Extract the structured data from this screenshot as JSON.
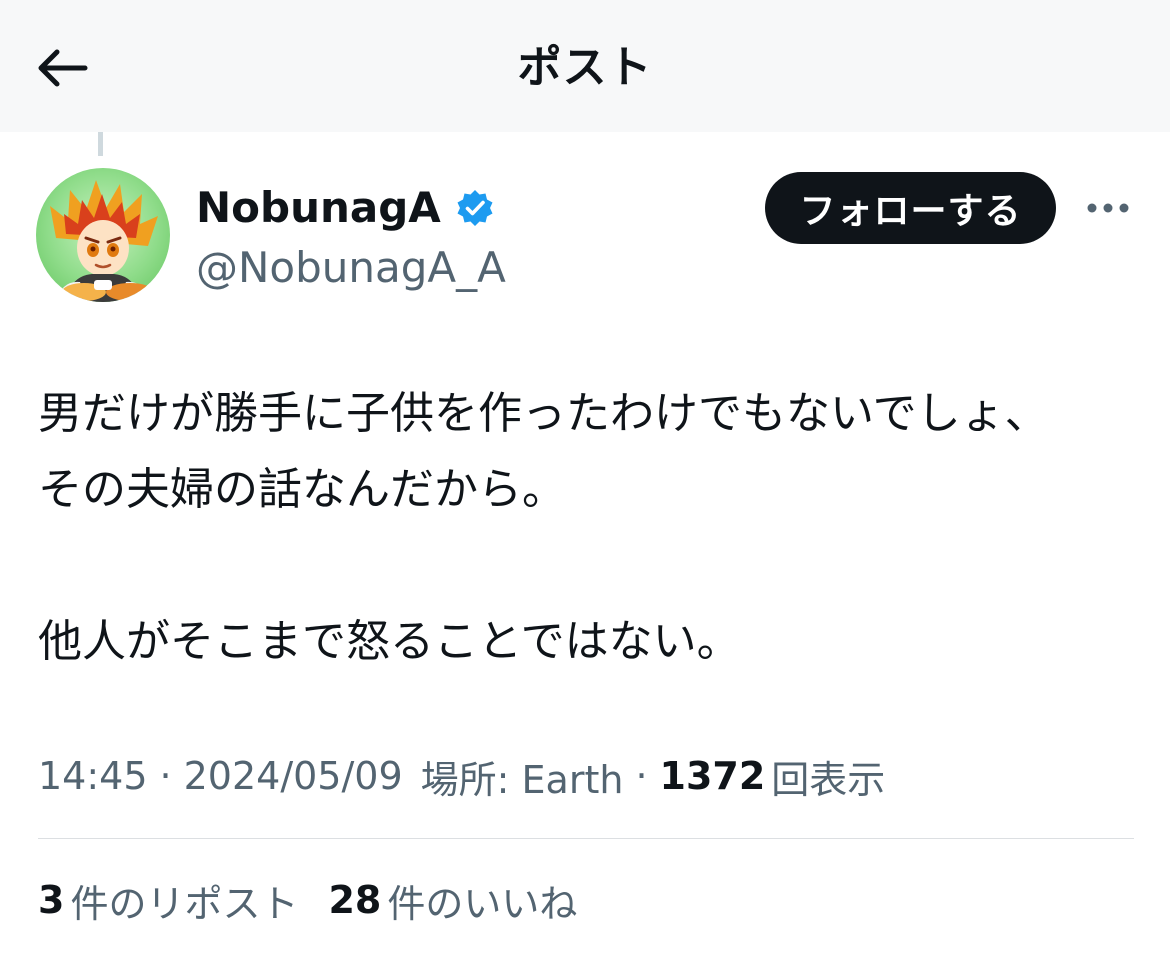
{
  "header": {
    "title": "ポスト",
    "back_icon": "arrow-left-icon"
  },
  "author": {
    "display_name": "NobunagA",
    "handle": "@NobunagA_A",
    "verified_icon": "verified-badge-icon",
    "verified_color": "#1d9bf0"
  },
  "actions": {
    "follow_label": "フォローする",
    "more_icon": "more-horizontal-icon"
  },
  "post": {
    "lines": [
      "男だけが勝手に子供を作ったわけでもないでしょ、",
      "その夫婦の話なんだから。",
      "他人がそこまで怒ることではない。"
    ]
  },
  "meta": {
    "time": "14:45",
    "date": "2024/05/09",
    "location": "場所: Earth",
    "views_count": "1372",
    "views_label": "回表示"
  },
  "stats": {
    "reposts_count": "3",
    "reposts_label": "件のリポスト",
    "likes_count": "28",
    "likes_label": "件のいいね"
  },
  "colors": {
    "text_primary": "#0f1419",
    "text_secondary": "#536471",
    "follow_button_bg": "#0f1419",
    "divider": "#dcdfe2"
  }
}
